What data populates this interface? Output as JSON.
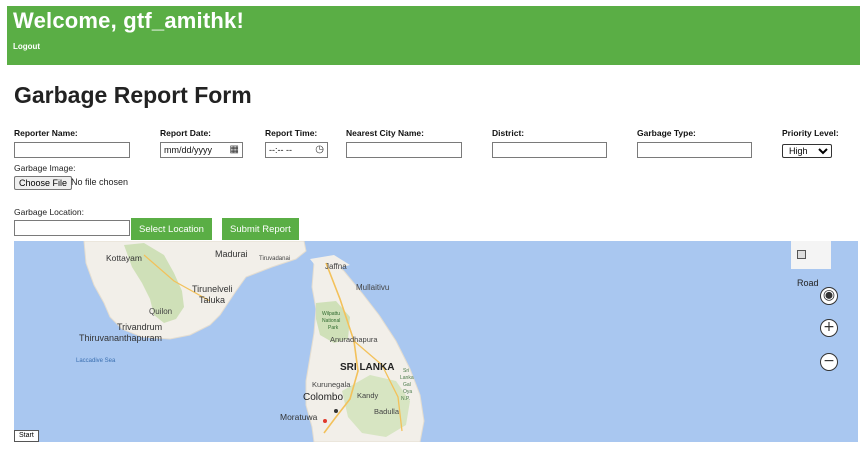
{
  "header": {
    "welcome": "Welcome, gtf_amithk!",
    "logout": "Logout",
    "background": "#5aae45"
  },
  "form": {
    "title": "Garbage Report Form",
    "reporter_name": {
      "label": "Reporter Name:",
      "value": ""
    },
    "report_date": {
      "label": "Report Date:",
      "placeholder": "mm/dd/yyyy"
    },
    "report_time": {
      "label": "Report Time:",
      "placeholder": "--:-- --"
    },
    "nearest_city": {
      "label": "Nearest City Name:",
      "value": ""
    },
    "district": {
      "label": "District:",
      "value": ""
    },
    "garbage_type": {
      "label": "Garbage Type:",
      "value": ""
    },
    "priority": {
      "label": "Priority Level:",
      "selected": "High"
    },
    "image": {
      "label": "Garbage Image:",
      "button": "Choose File",
      "status": "No file chosen"
    },
    "location": {
      "label": "Garbage Location:",
      "value": ""
    },
    "select_location": "Select Location",
    "submit": "Submit Report"
  },
  "map": {
    "map_type": "Road",
    "start": "Start",
    "labels": {
      "kottayam": "Kottayam",
      "madurai": "Madurai",
      "tiruvadanai": "Tiruvadanai",
      "jaffna": "Jaffna",
      "tirunelveli": "Tirunelveli",
      "taluka": "Taluka",
      "mullaitivu": "Mullaitivu",
      "quilon": "Quilon",
      "wilpattu1": "Wilpattu",
      "wilpattu2": "National",
      "wilpattu3": "Park",
      "trivandrum": "Trivandrum",
      "thiruvananthapuram": "Thiruvananthapuram",
      "anuradhapura": "Anuradhapura",
      "laccadive": "Laccadive Sea",
      "sri_lanka": "SRI LANKA",
      "kurunegala": "Kurunegala",
      "kandy": "Kandy",
      "colombo": "Colombo",
      "badulla": "Badulla",
      "moratuwa": "Moratuwa",
      "sl1": "Sri",
      "sl2": "Lanka",
      "sl3": "Gal",
      "sl4": "Oya",
      "sl5": "N.P."
    },
    "colors": {
      "water": "#a9c7f0",
      "land": "#f2efe9",
      "forest": "#cfe0b8",
      "road": "#f3c15a"
    }
  }
}
